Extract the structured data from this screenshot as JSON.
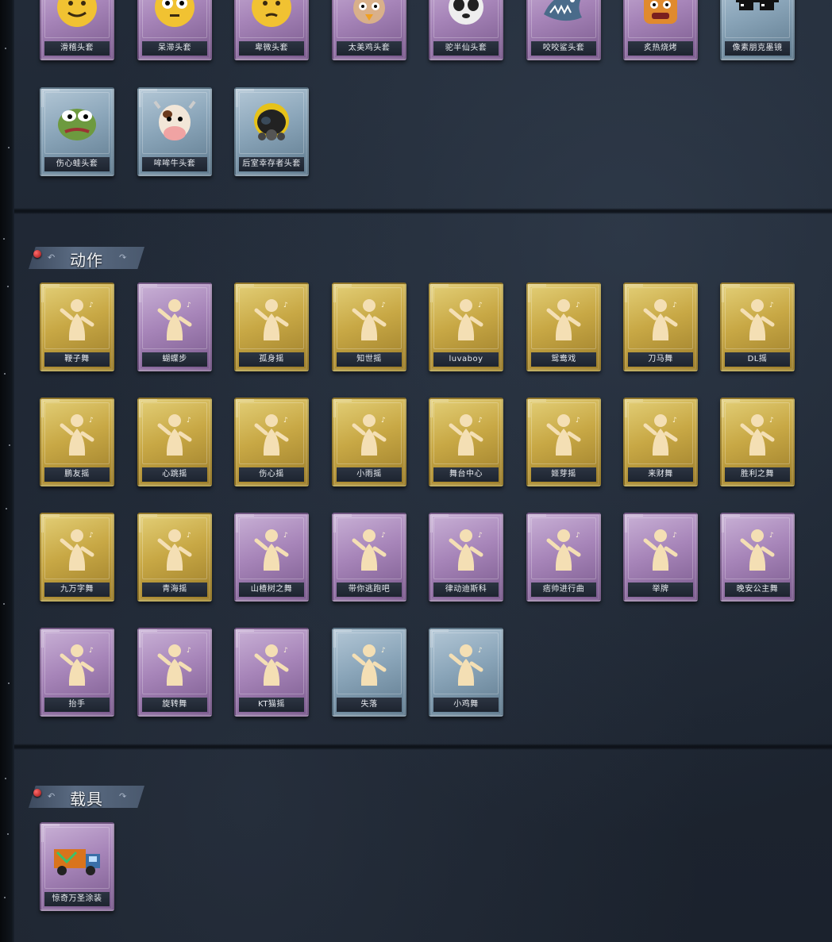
{
  "sections": {
    "actions_title": "动作",
    "vehicles_title": "载具"
  },
  "headgear": [
    {
      "label": "滑稽头套",
      "rarity": "purple",
      "icon": "smirk-face-head-icon",
      "color": "#f1c232"
    },
    {
      "label": "呆滞头套",
      "rarity": "purple",
      "icon": "dazed-face-head-icon",
      "color": "#f1c232"
    },
    {
      "label": "卑微头套",
      "rarity": "purple",
      "icon": "pleading-face-head-icon",
      "color": "#f1c232"
    },
    {
      "label": "太美鸡头套",
      "rarity": "purple",
      "icon": "chicken-head-icon",
      "color": "#d9b08a"
    },
    {
      "label": "驼半仙头套",
      "rarity": "purple",
      "icon": "panda-head-icon",
      "color": "#eeeeee"
    },
    {
      "label": "咬咬鲨头套",
      "rarity": "purple",
      "icon": "shark-head-icon",
      "color": "#4a6b8a"
    },
    {
      "label": "炙热烧烤",
      "rarity": "purple",
      "icon": "toast-face-head-icon",
      "color": "#e08a2e"
    },
    {
      "label": "像素朋克墨镜",
      "rarity": "blue",
      "icon": "pixel-sunglasses-icon",
      "color": "#111111"
    },
    {
      "label": "伤心蛙头套",
      "rarity": "blue",
      "icon": "sad-frog-head-icon",
      "color": "#6d9a3f"
    },
    {
      "label": "哞哞牛头套",
      "rarity": "blue",
      "icon": "cow-head-icon",
      "color": "#f2e6d8"
    },
    {
      "label": "后室幸存者头套",
      "rarity": "blue",
      "icon": "gas-mask-helmet-icon",
      "color": "#222222"
    }
  ],
  "actions": [
    {
      "label": "鞭子舞",
      "rarity": "gold"
    },
    {
      "label": "蝴蝶步",
      "rarity": "purple"
    },
    {
      "label": "孤身摇",
      "rarity": "gold"
    },
    {
      "label": "知世摇",
      "rarity": "gold"
    },
    {
      "label": "luvaboy",
      "rarity": "gold"
    },
    {
      "label": "鸳鸯戏",
      "rarity": "gold"
    },
    {
      "label": "刀马舞",
      "rarity": "gold"
    },
    {
      "label": "DL摇",
      "rarity": "gold"
    },
    {
      "label": "鹏友摇",
      "rarity": "gold"
    },
    {
      "label": "心跳摇",
      "rarity": "gold"
    },
    {
      "label": "伤心摇",
      "rarity": "gold"
    },
    {
      "label": "小雨摇",
      "rarity": "gold"
    },
    {
      "label": "舞台中心",
      "rarity": "gold"
    },
    {
      "label": "姬芽摇",
      "rarity": "gold"
    },
    {
      "label": "来财舞",
      "rarity": "gold"
    },
    {
      "label": "胜利之舞",
      "rarity": "gold"
    },
    {
      "label": "九万字舞",
      "rarity": "gold"
    },
    {
      "label": "青海摇",
      "rarity": "gold"
    },
    {
      "label": "山楂树之舞",
      "rarity": "purple"
    },
    {
      "label": "带你逃跑吧",
      "rarity": "purple"
    },
    {
      "label": "律动迪斯科",
      "rarity": "purple"
    },
    {
      "label": "痞帅进行曲",
      "rarity": "purple"
    },
    {
      "label": "举牌",
      "rarity": "purple"
    },
    {
      "label": "晚安公主舞",
      "rarity": "purple"
    },
    {
      "label": "抬手",
      "rarity": "purple"
    },
    {
      "label": "旋转舞",
      "rarity": "purple"
    },
    {
      "label": "KT猫摇",
      "rarity": "purple"
    },
    {
      "label": "失落",
      "rarity": "blue"
    },
    {
      "label": "小鸡舞",
      "rarity": "blue"
    }
  ],
  "vehicles": [
    {
      "label": "惊奇万圣涂装",
      "rarity": "purple",
      "icon": "halloween-truck-icon"
    }
  ]
}
